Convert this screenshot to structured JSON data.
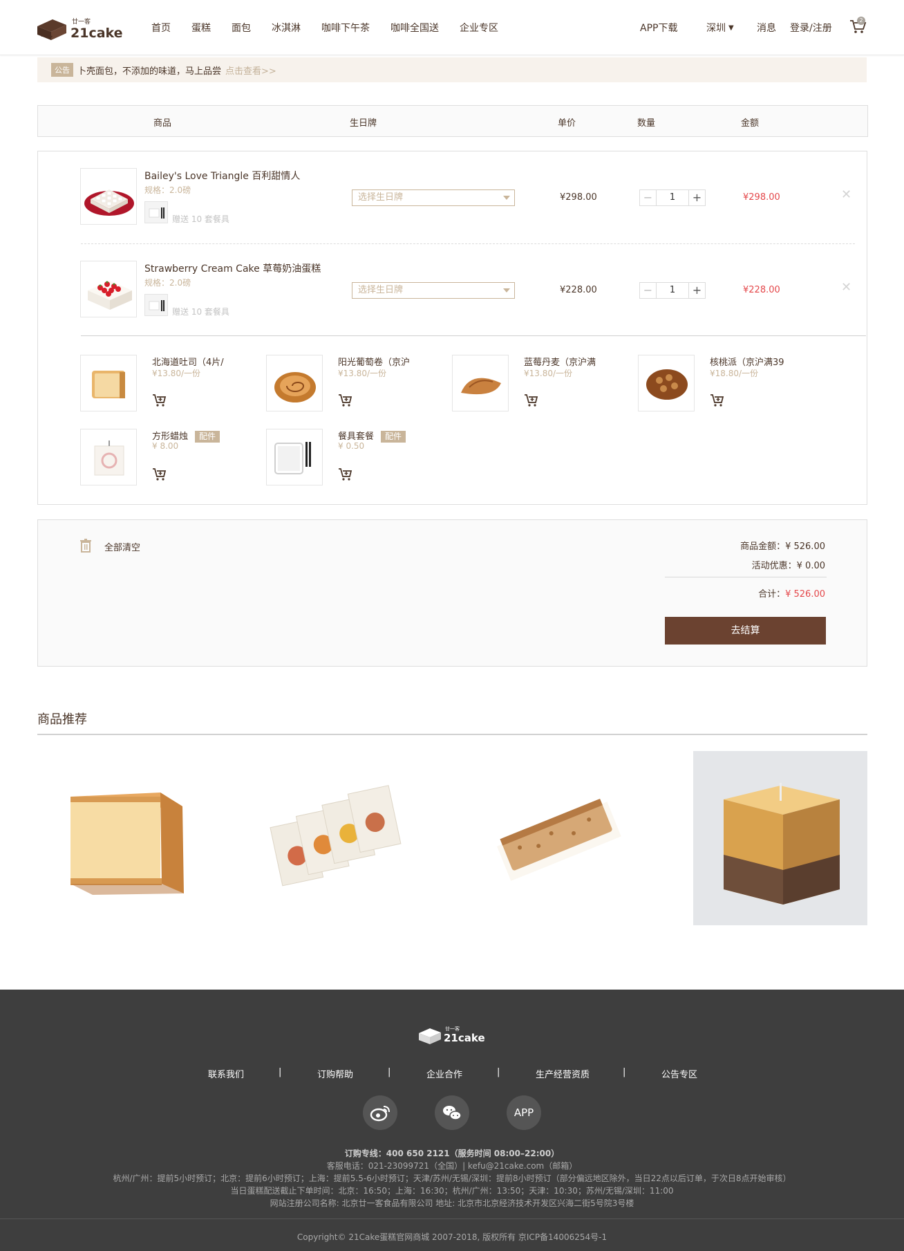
{
  "header": {
    "logo_small": "廿一客",
    "logo_big": "21cake",
    "nav": [
      "首页",
      "蛋糕",
      "面包",
      "冰淇淋",
      "咖啡下午茶",
      "咖啡全国送",
      "企业专区"
    ],
    "app_download": "APP下载",
    "city": "深圳",
    "messages": "消息",
    "login": "登录/注册",
    "cart_count": "2"
  },
  "notice": {
    "tag": "公告",
    "text": "卜壳面包，不添加的味道，马上品尝",
    "link": "点击查看>>"
  },
  "table_head": {
    "product": "商品",
    "birthday_card": "生日牌",
    "unit_price": "单价",
    "quantity": "数量",
    "amount": "金额"
  },
  "items": [
    {
      "name": "Bailey's Love Triangle 百利甜情人",
      "spec": "规格：2.0磅",
      "gift": "赠送 10 套餐具",
      "birthday_placeholder": "选择生日牌",
      "price": "¥298.00",
      "qty": "1",
      "amount": "¥298.00"
    },
    {
      "name": "Strawberry Cream Cake 草莓奶油蛋糕",
      "spec": "规格：2.0磅",
      "gift": "赠送 10 套餐具",
      "birthday_placeholder": "选择生日牌",
      "price": "¥228.00",
      "qty": "1",
      "amount": "¥228.00"
    }
  ],
  "accessories": [
    {
      "name": "北海道吐司（4片/",
      "price": "¥13.80/一份",
      "tag": ""
    },
    {
      "name": "阳光葡萄卷（京沪",
      "price": "¥13.80/一份",
      "tag": ""
    },
    {
      "name": "蓝莓丹麦（京沪满",
      "price": "¥13.80/一份",
      "tag": ""
    },
    {
      "name": "核桃派（京沪满39",
      "price": "¥18.80/一份",
      "tag": ""
    },
    {
      "name": "方形蜡烛",
      "price": "¥ 8.00",
      "tag": "配件"
    },
    {
      "name": "餐具套餐",
      "price": "¥ 0.50",
      "tag": "配件"
    }
  ],
  "summary": {
    "clear_all": "全部清空",
    "goods_amount": "商品金额：¥ 526.00",
    "discount": "活动优惠：¥ 0.00",
    "total_label": "合计：",
    "total_value": "¥ 526.00",
    "checkout": "去结算"
  },
  "recommend": {
    "title": "商品推荐"
  },
  "footer": {
    "logo_small": "廿一客",
    "logo_big": "21cake",
    "links": [
      "联系我们",
      "订购帮助",
      "企业合作",
      "生产经营资质",
      "公告专区"
    ],
    "separator": "|",
    "app": "APP",
    "hotline": "订购专线：400 650 2121（服务时间 08:00–22:00）",
    "service": "客服电话：021-23099721（全国）| kefu@21cake.com（邮箱）",
    "advance": "杭州/广州：提前5小时预订；北京：提前6小时预订；上海：提前5.5-6小时预订；天津/苏州/无锡/深圳：提前8小时预订（部分偏远地区除外，当日22点以后订单，于次日8点开始审核）",
    "deadline": "当日蛋糕配送截止下单时间：北京：16:50；上海：16:30；杭州/广州：13:50；天津：10:30；苏州/无锡/深圳：11:00",
    "company": "网站注册公司名称: 北京廿一客食品有限公司 地址: 北京市北京经济技术开发区兴海二街5号院3号楼",
    "copyright": "Copyright© 21Cake蛋糕官网商城 2007-2018, 版权所有 京ICP备14006254号-1"
  }
}
